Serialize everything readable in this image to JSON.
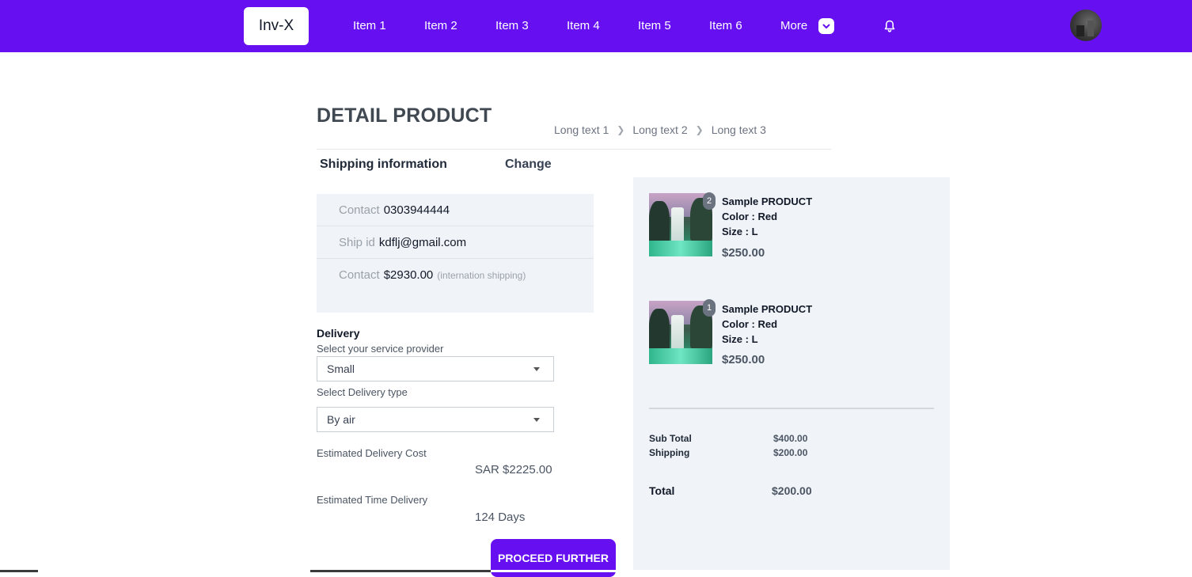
{
  "app": {
    "logo": "Inv-X"
  },
  "nav": {
    "items": [
      "Item 1",
      "Item 2",
      "Item 3",
      "Item 4",
      "Item 5",
      "Item 6"
    ],
    "more": "More",
    "icons": {
      "more": "chevron-down-icon",
      "notifications": "bell-icon"
    },
    "accent": "#6610f2"
  },
  "page": {
    "title": "DETAIL PRODUCT",
    "breadcrumb": [
      "Long text 1",
      "Long text 2",
      "Long text 3"
    ]
  },
  "shipping": {
    "title": "Shipping information",
    "change": "Change",
    "rows": [
      {
        "label": "Contact",
        "value": "0303944444",
        "note": ""
      },
      {
        "label": "Ship id",
        "value": "kdflj@gmail.com",
        "note": ""
      },
      {
        "label": "Contact",
        "value": "$2930.00",
        "note": "(internation shipping)"
      }
    ]
  },
  "delivery": {
    "heading": "Delivery",
    "provider_label": "Select your service provider",
    "provider_value": "Small",
    "type_label": "Select Delivery type",
    "type_value": "By air",
    "cost_label": "Estimated Delivery Cost",
    "cost_value": "SAR $2225.00",
    "time_label": "Estimated Time Delivery",
    "time_value": "124 Days"
  },
  "actions": {
    "proceed": "PROCEED FURTHER"
  },
  "cart": {
    "items": [
      {
        "qty": "2",
        "name": "Sample PRODUCT",
        "color": "Color : Red",
        "size": "Size : L",
        "price": "$250.00"
      },
      {
        "qty": "1",
        "name": "Sample PRODUCT",
        "color": "Color : Red",
        "size": "Size : L",
        "price": "$250.00"
      }
    ],
    "subtotal_label": "Sub Total",
    "subtotal_value": "$400.00",
    "shipping_label": "Shipping",
    "shipping_value": "$200.00",
    "total_label": "Total",
    "total_value": "$200.00"
  }
}
